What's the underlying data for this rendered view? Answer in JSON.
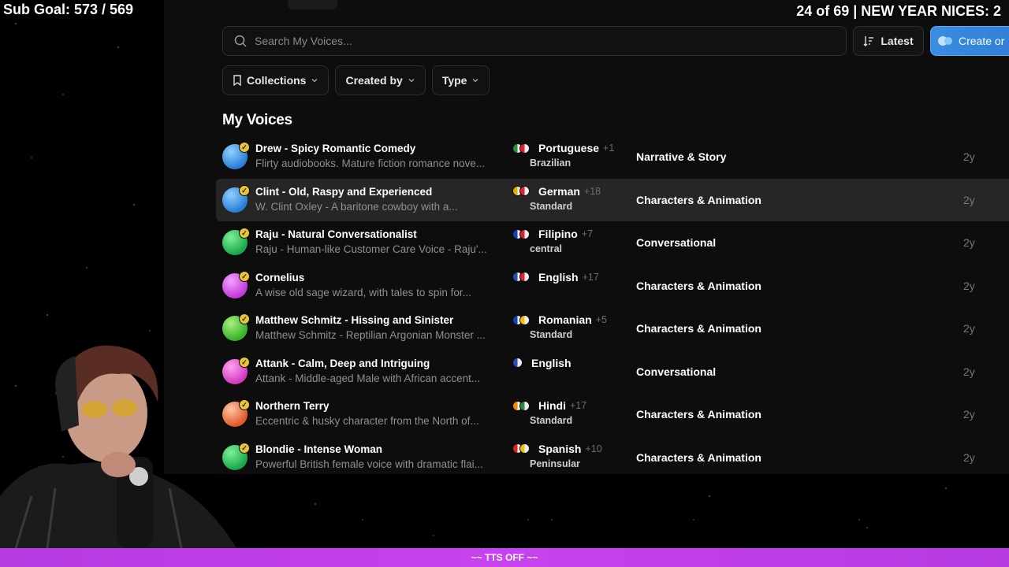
{
  "overlay": {
    "sub_goal": "Sub Goal: 573 / 569",
    "counter": "24 of 69 | NEW YEAR NICES: 2",
    "tts_status": "~~ TTS OFF ~~"
  },
  "search": {
    "placeholder": "Search My Voices..."
  },
  "toolbar": {
    "sort_label": "Latest",
    "create_label": "Create or"
  },
  "filters": [
    {
      "label": "Collections"
    },
    {
      "label": "Created by"
    },
    {
      "label": "Type"
    }
  ],
  "section_title": "My Voices",
  "voices": [
    {
      "name": "Drew - Spicy Romantic Comedy",
      "desc": "Flirty audiobooks. Mature fiction romance nove...",
      "lang": "Portuguese",
      "more": "+1",
      "accent": "Brazilian",
      "category": "Narrative & Story",
      "age": "2y",
      "avatar": [
        "#2a7fd4",
        "#8fd0ff"
      ],
      "flags": [
        "#2e8b3a",
        "#d23"
      ]
    },
    {
      "name": "Clint - Old, Raspy and Experienced",
      "desc": "W. Clint Oxley - A baritone cowboy with a...",
      "lang": "German",
      "more": "+18",
      "accent": "Standard",
      "category": "Characters & Animation",
      "age": "2y",
      "avatar": [
        "#2a7fd4",
        "#8fd0ff"
      ],
      "flags": [
        "#e2b100",
        "#d23"
      ]
    },
    {
      "name": "Raju - Natural Conversationalist",
      "desc": "Raju - Human-like Customer Care Voice - Raju'...",
      "lang": "Filipino",
      "more": "+7",
      "accent": "central",
      "category": "Conversational",
      "age": "2y",
      "avatar": [
        "#1aa84a",
        "#7ef09a"
      ],
      "flags": [
        "#1d3fb0",
        "#d23"
      ]
    },
    {
      "name": "Cornelius",
      "desc": "A wise old sage wizard, with tales to spin for...",
      "lang": "English",
      "more": "+17",
      "accent": "",
      "category": "Characters & Animation",
      "age": "2y",
      "avatar": [
        "#c23ad8",
        "#f3a3ff"
      ],
      "flags": [
        "#2a4fb0",
        "#d23"
      ]
    },
    {
      "name": "Matthew Schmitz - Hissing and Sinister",
      "desc": "Matthew Schmitz - Reptilian Argonian Monster ...",
      "lang": "Romanian",
      "more": "+5",
      "accent": "Standard",
      "category": "Characters & Animation",
      "age": "2y",
      "avatar": [
        "#38b02a",
        "#a6f07e"
      ],
      "flags": [
        "#1d3fb0",
        "#f2c200"
      ]
    },
    {
      "name": "Attank - Calm, Deep and Intriguing",
      "desc": "Attank - Middle-aged Male with African accent...",
      "lang": "English",
      "more": "",
      "accent": "",
      "category": "Conversational",
      "age": "2y",
      "avatar": [
        "#d23ac0",
        "#ffa3ee"
      ],
      "flags": [
        "#2a4fb0"
      ]
    },
    {
      "name": "Northern Terry",
      "desc": "Eccentric & husky character from the North of...",
      "lang": "Hindi",
      "more": "+17",
      "accent": "Standard",
      "category": "Characters & Animation",
      "age": "2y",
      "avatar": [
        "#e05a2a",
        "#ffc6a3"
      ],
      "flags": [
        "#f28c00",
        "#2e8b3a"
      ]
    },
    {
      "name": "Blondie - Intense Woman",
      "desc": "Powerful British female voice with dramatic flai...",
      "lang": "Spanish",
      "more": "+10",
      "accent": "Peninsular",
      "category": "Characters & Animation",
      "age": "2y",
      "avatar": [
        "#1aa84a",
        "#7ef09a"
      ],
      "flags": [
        "#d22",
        "#f2c200"
      ]
    }
  ]
}
